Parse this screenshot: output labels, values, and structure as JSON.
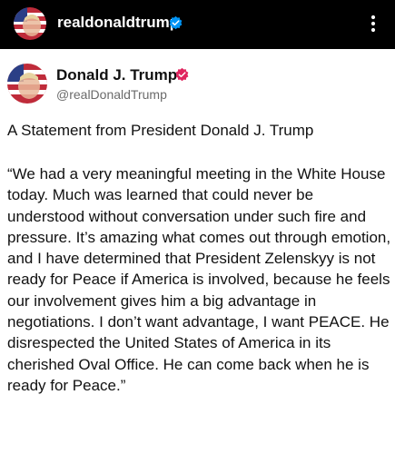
{
  "header": {
    "username": "realdonaldtrump",
    "verified_icon": "verified-check-icon",
    "more_icon": "more-vertical-icon"
  },
  "post": {
    "display_name": "Donald J. Trump",
    "handle": "@realDonaldTrump",
    "badge_icon": "verified-badge-icon",
    "badge_color": "#e0245e",
    "title": "A Statement from President Donald J. Trump",
    "body": "“We had a very meaningful meeting in the White House today. Much was learned that could never be understood without conversation under such fire and pressure. It’s amazing what comes out through emotion, and I have determined that President Zelenskyy is not ready for Peace if America is involved, because he feels our involvement gives him a big advantage in negotiations. I don’t want advantage, I want PEACE. He disrespected the United States of America in its cherished Oval Office. He can come back when he is ready for Peace.”"
  },
  "colors": {
    "topbar_bg": "#000000",
    "verified_blue": "#0095f6",
    "text": "#111111",
    "muted": "#6b6b6b"
  }
}
